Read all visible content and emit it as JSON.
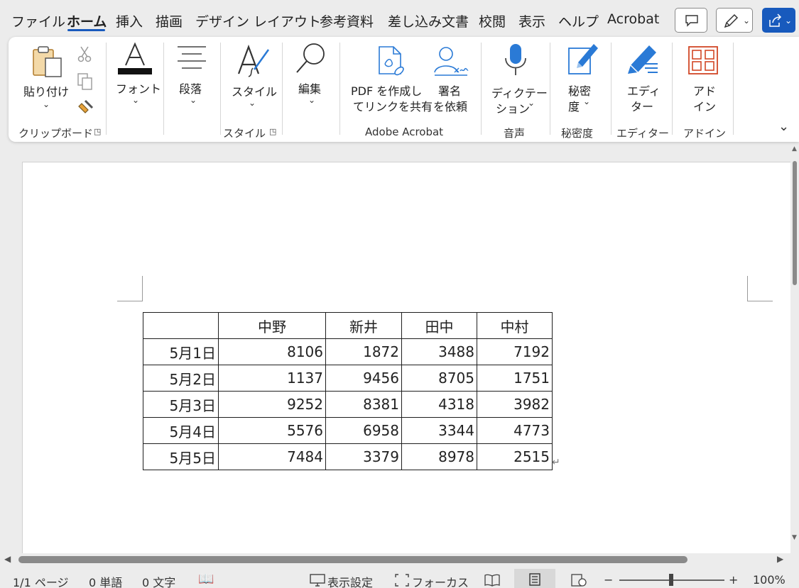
{
  "menu": {
    "tabs": [
      "ファイル",
      "ホーム",
      "挿入",
      "描画",
      "デザイン",
      "レイアウト",
      "参考資料",
      "差し込み文書",
      "校閲",
      "表示",
      "ヘルプ",
      "Acrobat"
    ],
    "active_tab": "ホーム"
  },
  "ribbon": {
    "paste_label": "貼り付け",
    "clipboard_group": "クリップボード",
    "font_label": "フォント",
    "paragraph_label": "段落",
    "style_label": "スタイル",
    "style_group": "スタイル",
    "edit_label": "編集",
    "pdf_label_1": "PDF を作成し",
    "pdf_label_2": "てリンクを共有",
    "sign_label_1": "署名",
    "sign_label_2": "を依頼",
    "acrobat_group": "Adobe Acrobat",
    "dictate_label_1": "ディクテー",
    "dictate_label_2": "ション",
    "voice_group": "音声",
    "sensitivity_label_1": "秘密",
    "sensitivity_label_2": "度",
    "sensitivity_group": "秘密度",
    "editor_label_1": "エディ",
    "editor_label_2": "ター",
    "editor_group": "エディター",
    "addin_label_1": "アド",
    "addin_label_2": "イン",
    "addin_group": "アドイン"
  },
  "table": {
    "headers": [
      "",
      "中野",
      "新井",
      "田中",
      "中村"
    ],
    "rows": [
      [
        "5月1日",
        "8106",
        "1872",
        "3488",
        "7192"
      ],
      [
        "5月2日",
        "1137",
        "9456",
        "8705",
        "1751"
      ],
      [
        "5月3日",
        "9252",
        "8381",
        "4318",
        "3982"
      ],
      [
        "5月4日",
        "5576",
        "6958",
        "3344",
        "4773"
      ],
      [
        "5月5日",
        "7484",
        "3379",
        "8978",
        "2515"
      ]
    ]
  },
  "status": {
    "page": "1/1 ページ",
    "words": "0 単語",
    "chars": "0 文字",
    "display_settings": "表示設定",
    "focus": "フォーカス",
    "zoom": "100%"
  },
  "colors": {
    "accent": "#185abd",
    "acrobat_blue": "#2a7ad6",
    "addin_orange": "#d24726"
  }
}
